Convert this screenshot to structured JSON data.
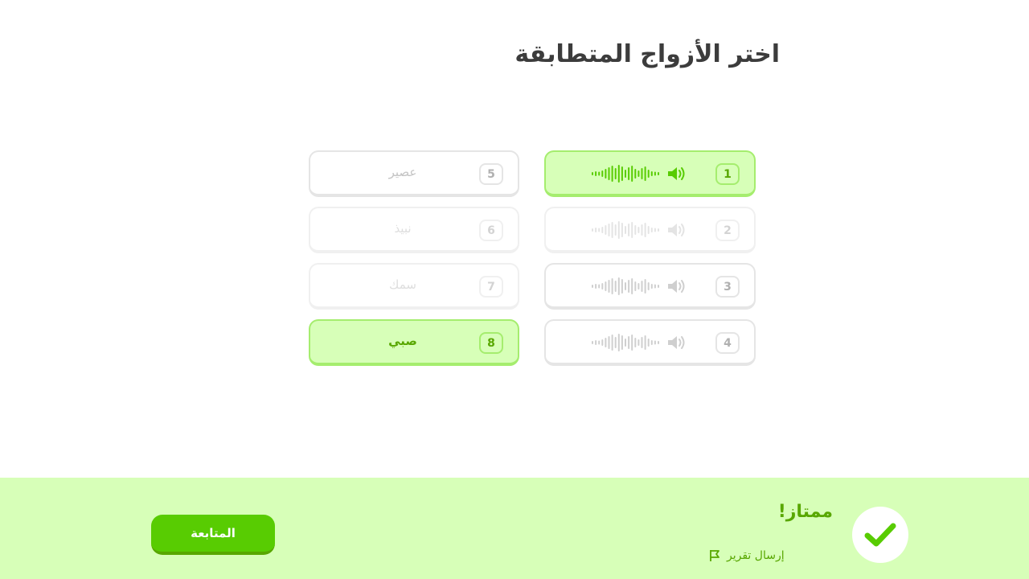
{
  "header": {
    "title": "اختر الأزواج المتطابقة"
  },
  "audio_cards": [
    {
      "number": "1",
      "state": "matched"
    },
    {
      "number": "2",
      "state": "faded"
    },
    {
      "number": "3",
      "state": "default"
    },
    {
      "number": "4",
      "state": "default"
    }
  ],
  "word_cards": [
    {
      "number": "5",
      "word": "عصير",
      "state": "default"
    },
    {
      "number": "6",
      "word": "نبيذ",
      "state": "faded"
    },
    {
      "number": "7",
      "word": "سمك",
      "state": "faded"
    },
    {
      "number": "8",
      "word": "صبي",
      "state": "matched"
    }
  ],
  "footer": {
    "result_title": "ممتاز!",
    "report_label": "إرسال تقرير",
    "continue_label": "المتابعة"
  },
  "colors": {
    "accent_green": "#58cc02",
    "matched_bg": "#d7ffb8",
    "matched_border": "#a5ed6e",
    "text_green": "#58a700"
  }
}
